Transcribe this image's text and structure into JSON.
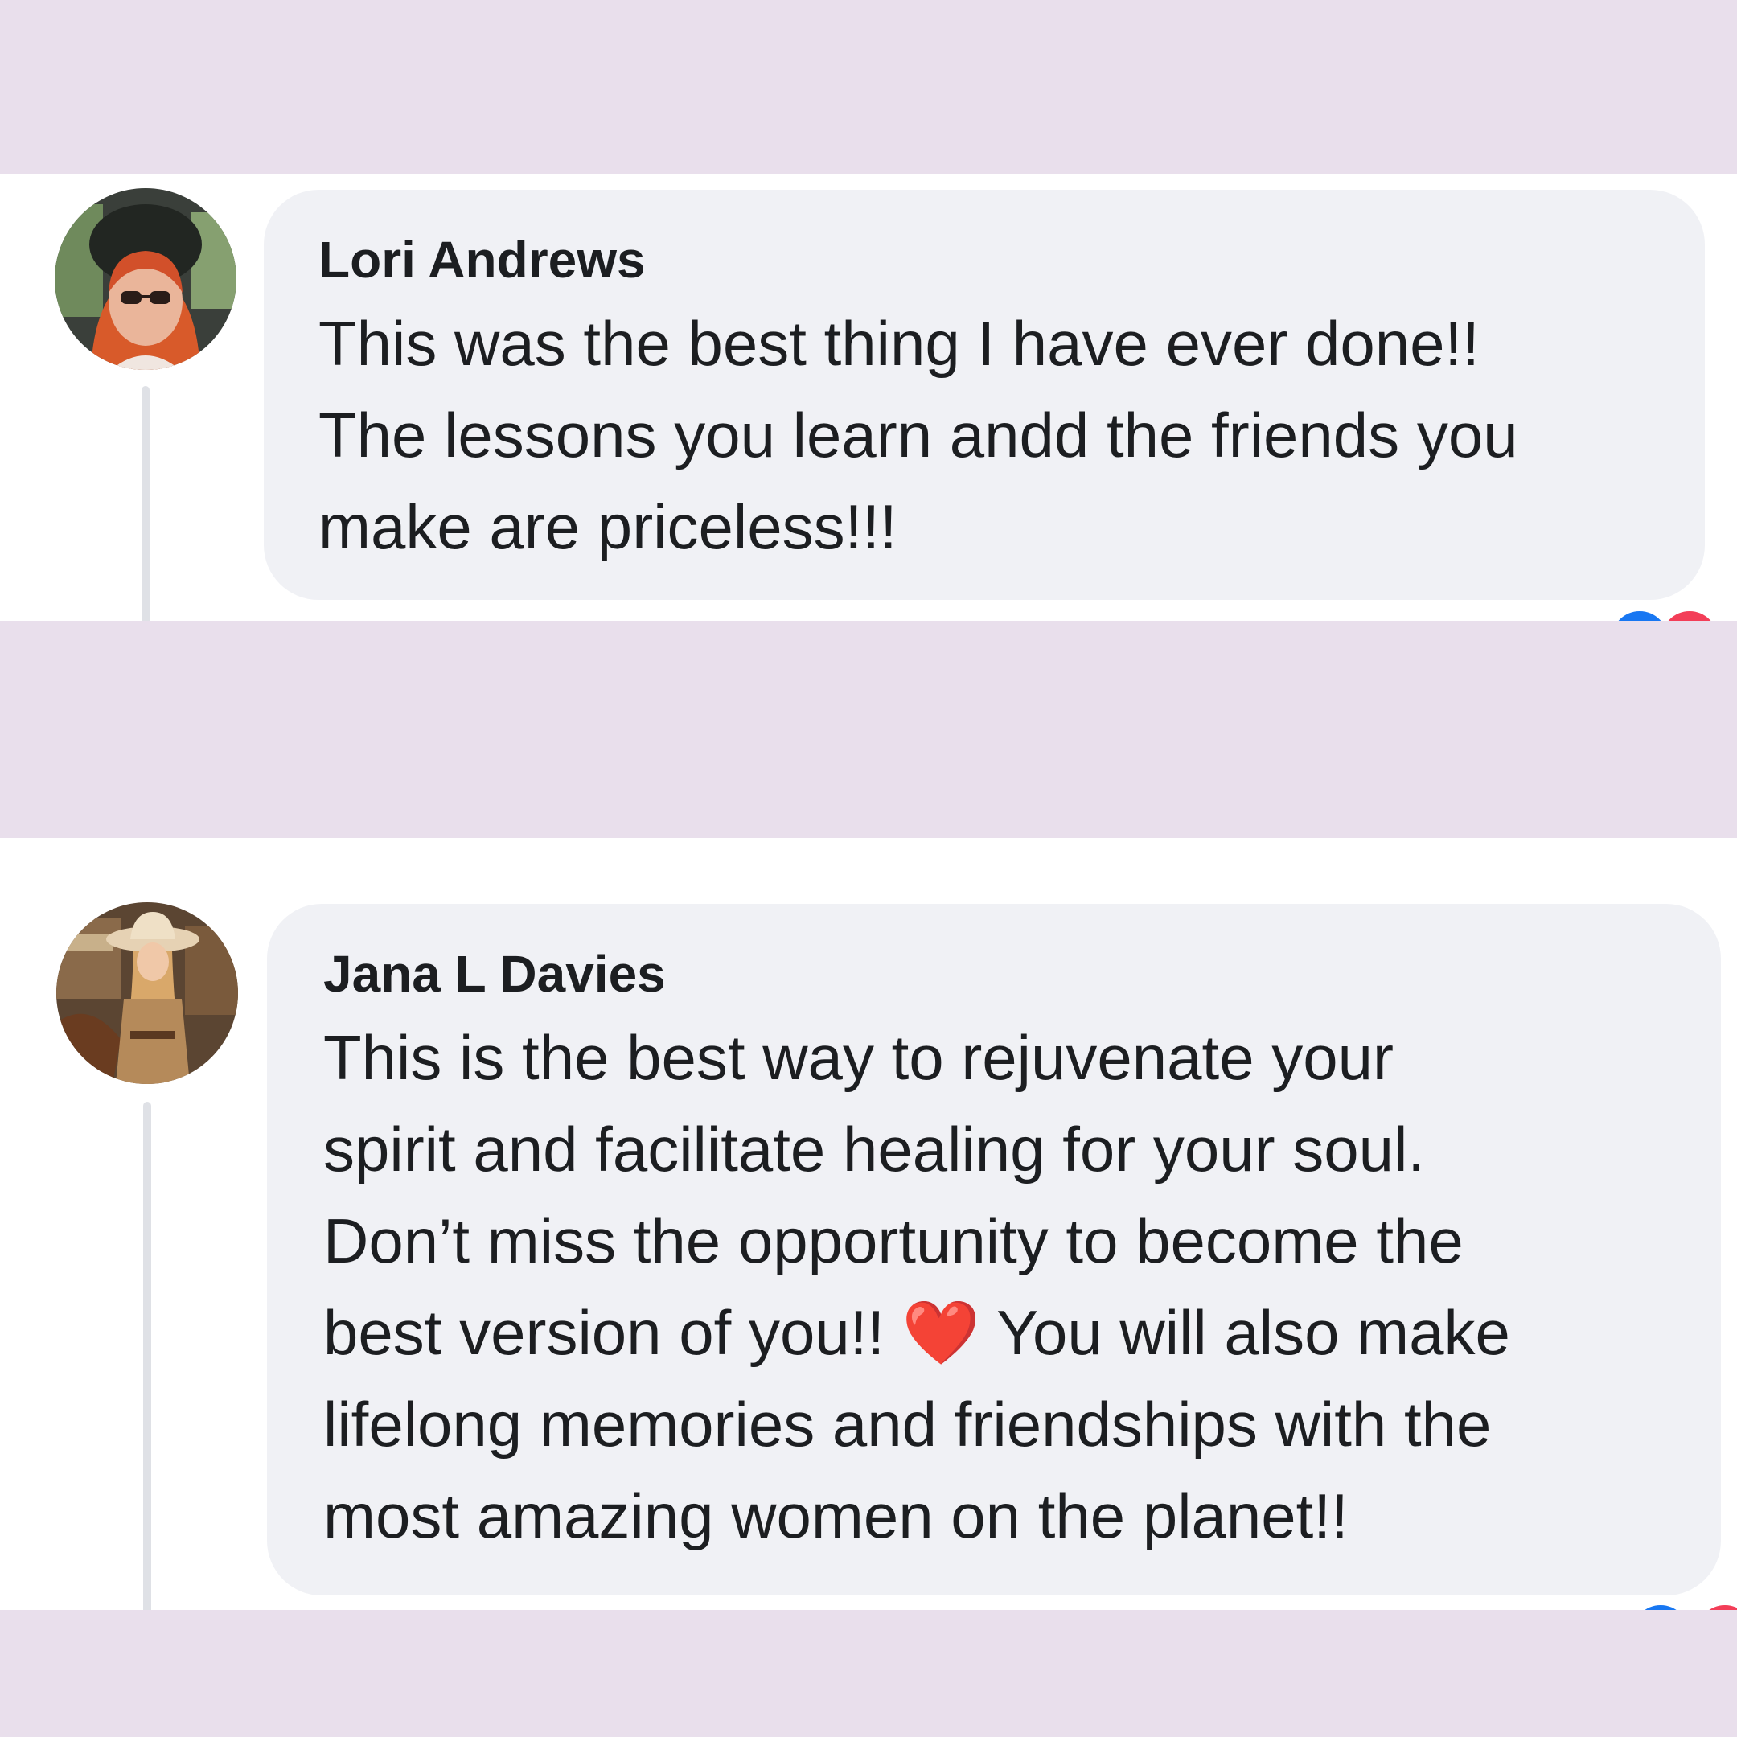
{
  "comments": [
    {
      "author": "Lori Andrews",
      "lines": [
        "This was the best thing I have ever done!!",
        "The lessons you learn andd the friends you",
        "make are priceless!!!"
      ],
      "avatar_icon": "avatar-red-haired-woman-in-car"
    },
    {
      "author": "Jana L Davies",
      "lines": [
        "This is the best way to rejuvenate your",
        "spirit and facilitate healing for your soul.",
        "Don’t miss the opportunity to become the",
        "best version of you!!",
        "❤️",
        "You will also make",
        "lifelong memories and friendships with the",
        "most amazing women on the planet!!"
      ],
      "avatar_icon": "avatar-cowgirl-on-horse"
    }
  ],
  "reaction_icons": [
    "like-icon",
    "love-icon"
  ],
  "colors": {
    "background": "#e9dfec",
    "panel": "#ffffff",
    "bubble": "#f0f1f5",
    "text": "#1c1e21",
    "like": "#1877f2",
    "love": "#f33e58"
  }
}
